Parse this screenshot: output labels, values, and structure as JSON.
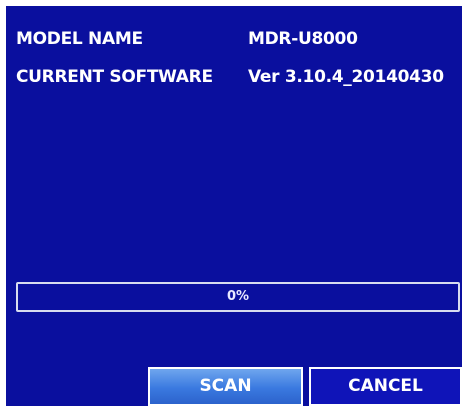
{
  "info": {
    "model_label": "MODEL NAME",
    "model_value": "MDR-U8000",
    "software_label": "CURRENT SOFTWARE",
    "software_value": "Ver 3.10.4_20140430"
  },
  "progress": {
    "percent": 0,
    "text": "0%"
  },
  "buttons": {
    "scan_label": "SCAN",
    "cancel_label": "CANCEL"
  },
  "colors": {
    "background": "#0a0f9e",
    "scan_button": "#3a79e0",
    "cancel_button": "#0f14b8",
    "text": "#ffffff"
  }
}
